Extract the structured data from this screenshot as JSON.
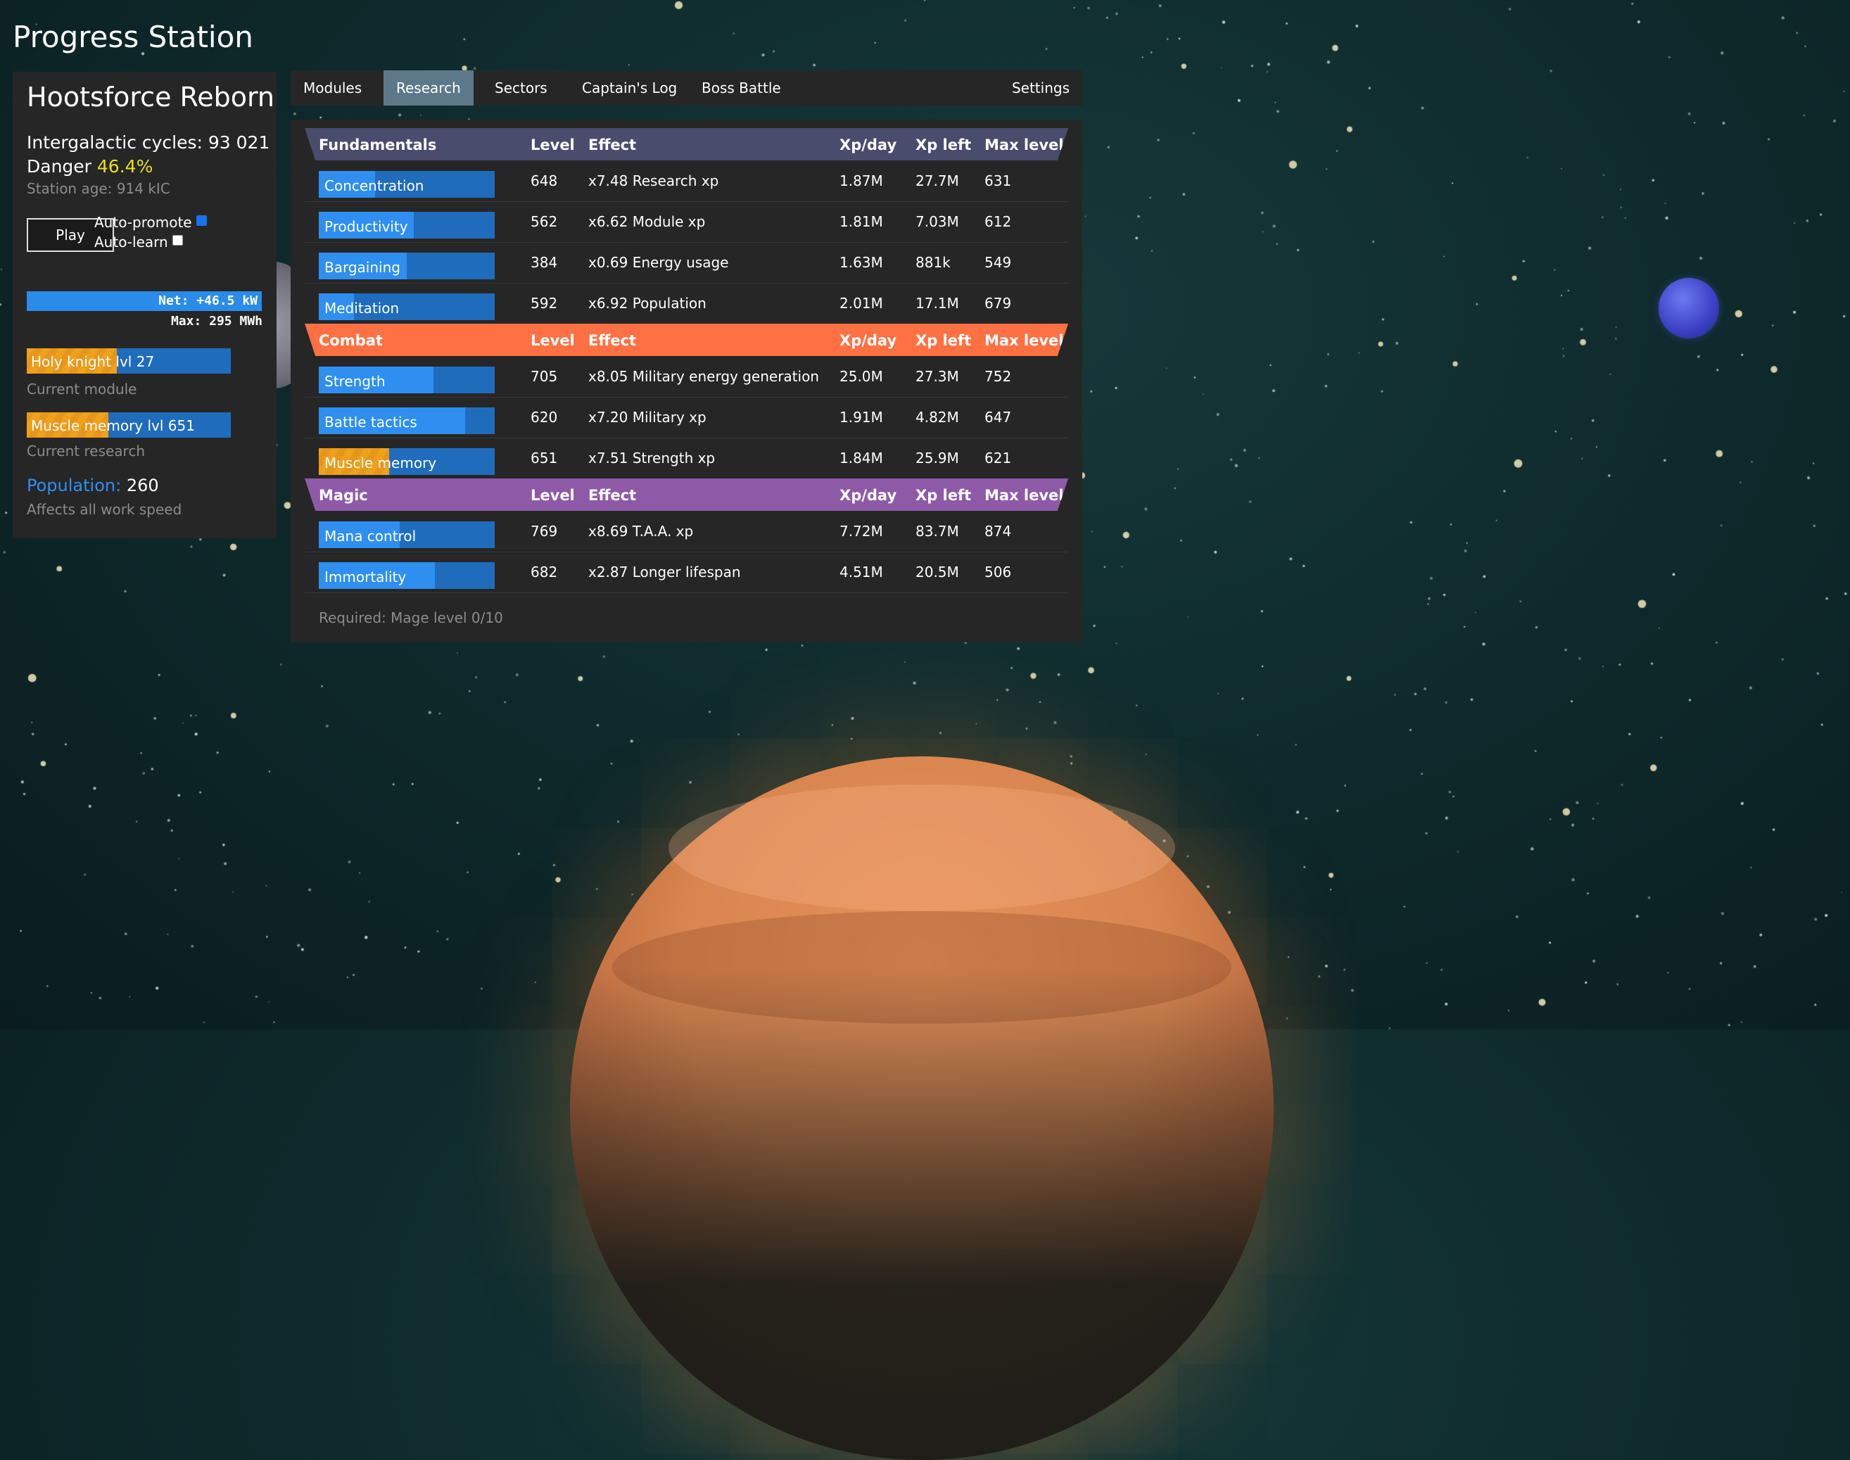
{
  "app_title": "Progress Station",
  "colors": {
    "fundamentals": "#4a4c6d",
    "combat": "#ff7043",
    "magic": "#8e5aa8",
    "bar_fill": "#2e8ff0",
    "bar_bg": "#1f6cbd",
    "active_fill": "#f0a11c",
    "danger": "#e6e21c"
  },
  "sidebar": {
    "empire_name": "Hootsforce Reborn",
    "cycles": "Intergalactic cycles: 93 021",
    "danger_label": "Danger",
    "danger_value": "46.4%",
    "station_age": "Station age: 914 kIC",
    "play_label": "Play",
    "auto_promote_label": "Auto-promote",
    "auto_promote_checked": true,
    "auto_learn_label": "Auto-learn",
    "auto_learn_checked": false,
    "net_energy": "Net: +46.5 kW",
    "max_energy": "Max: 295 MWh",
    "current_module": {
      "label": "Holy knight lvl 27",
      "progress": 0.44,
      "caption": "Current module"
    },
    "current_research": {
      "label": "Muscle memory lvl 651",
      "progress": 0.4,
      "caption": "Current research"
    },
    "population_label": "Population:",
    "population_value": "260",
    "population_caption": "Affects all work speed"
  },
  "tabs": [
    {
      "label": "Modules",
      "active": false
    },
    {
      "label": "Research",
      "active": true
    },
    {
      "label": "Sectors",
      "active": false
    },
    {
      "label": "Captain's Log",
      "active": false
    },
    {
      "label": "Boss Battle",
      "active": false
    },
    {
      "label": "Settings",
      "active": false
    }
  ],
  "columns": {
    "level": "Level",
    "effect": "Effect",
    "xp_day": "Xp/day",
    "xp_left": "Xp left",
    "max_level": "Max level"
  },
  "groups": [
    {
      "name": "Fundamentals",
      "color": "#4a4c6d",
      "rows": [
        {
          "name": "Concentration",
          "progress": 0.32,
          "active": false,
          "level": "648",
          "effect": "x7.48 Research xp",
          "xp_day": "1.87M",
          "xp_left": "27.7M",
          "max_level": "631"
        },
        {
          "name": "Productivity",
          "progress": 0.54,
          "active": false,
          "level": "562",
          "effect": "x6.62 Module xp",
          "xp_day": "1.81M",
          "xp_left": "7.03M",
          "max_level": "612"
        },
        {
          "name": "Bargaining",
          "progress": 0.5,
          "active": false,
          "level": "384",
          "effect": "x0.69 Energy usage",
          "xp_day": "1.63M",
          "xp_left": "881k",
          "max_level": "549"
        },
        {
          "name": "Meditation",
          "progress": 0.2,
          "active": false,
          "level": "592",
          "effect": "x6.92 Population",
          "xp_day": "2.01M",
          "xp_left": "17.1M",
          "max_level": "679"
        }
      ]
    },
    {
      "name": "Combat",
      "color": "#ff7043",
      "rows": [
        {
          "name": "Strength",
          "progress": 0.65,
          "active": false,
          "level": "705",
          "effect": "x8.05 Military energy generation",
          "xp_day": "25.0M",
          "xp_left": "27.3M",
          "max_level": "752"
        },
        {
          "name": "Battle tactics",
          "progress": 0.83,
          "active": false,
          "level": "620",
          "effect": "x7.20 Military xp",
          "xp_day": "1.91M",
          "xp_left": "4.82M",
          "max_level": "647"
        },
        {
          "name": "Muscle memory",
          "progress": 0.4,
          "active": true,
          "level": "651",
          "effect": "x7.51 Strength xp",
          "xp_day": "1.84M",
          "xp_left": "25.9M",
          "max_level": "621"
        }
      ]
    },
    {
      "name": "Magic",
      "color": "#8e5aa8",
      "rows": [
        {
          "name": "Mana control",
          "progress": 0.46,
          "active": false,
          "level": "769",
          "effect": "x8.69 T.A.A. xp",
          "xp_day": "7.72M",
          "xp_left": "83.7M",
          "max_level": "874"
        },
        {
          "name": "Immortality",
          "progress": 0.66,
          "active": false,
          "level": "682",
          "effect": "x2.87 Longer lifespan",
          "xp_day": "4.51M",
          "xp_left": "20.5M",
          "max_level": "506"
        }
      ]
    }
  ],
  "requirement": "Required: Mage level 0/10"
}
